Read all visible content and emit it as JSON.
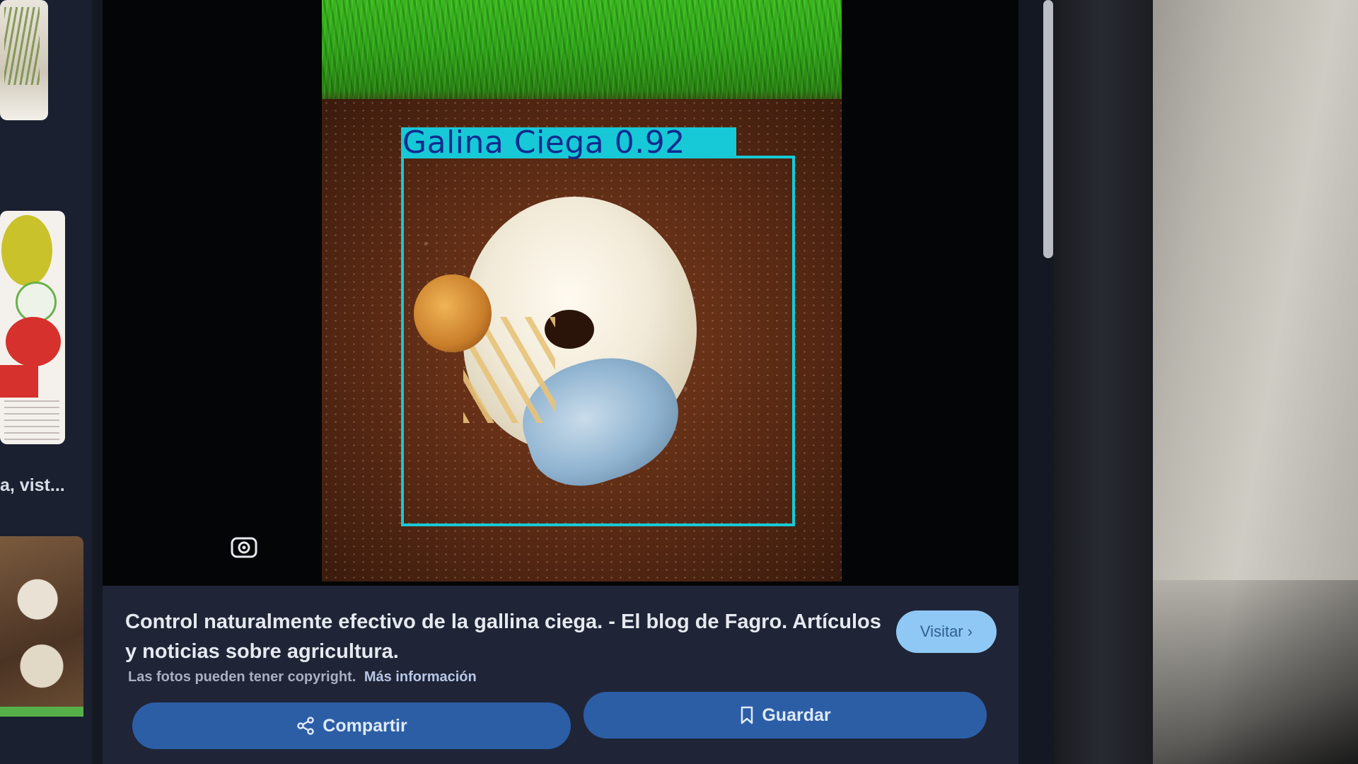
{
  "detection": {
    "label": "Galina  Ciega  0.92",
    "box_color": "#17c9d6",
    "label_text_color": "#0f2b8f"
  },
  "sidebar": {
    "partial_caption": "a, vist..."
  },
  "info_panel": {
    "title": "Control naturalmente efectivo de la gallina ciega. - El blog de Fagro. Artículos y noticias sobre agricultura.",
    "visit_label": "Visitar ›",
    "copyright_text": "Las fotos pueden tener copyright.",
    "more_info_label": "Más información",
    "share_label": "Compartir",
    "save_label": "Guardar"
  },
  "icons": {
    "lens": "lens-icon",
    "share": "share-icon",
    "save": "bookmark-icon"
  },
  "colors": {
    "panel_bg": "#1f2536",
    "button_bg": "#2c5ea6",
    "visit_bg": "#8fc8f5"
  }
}
